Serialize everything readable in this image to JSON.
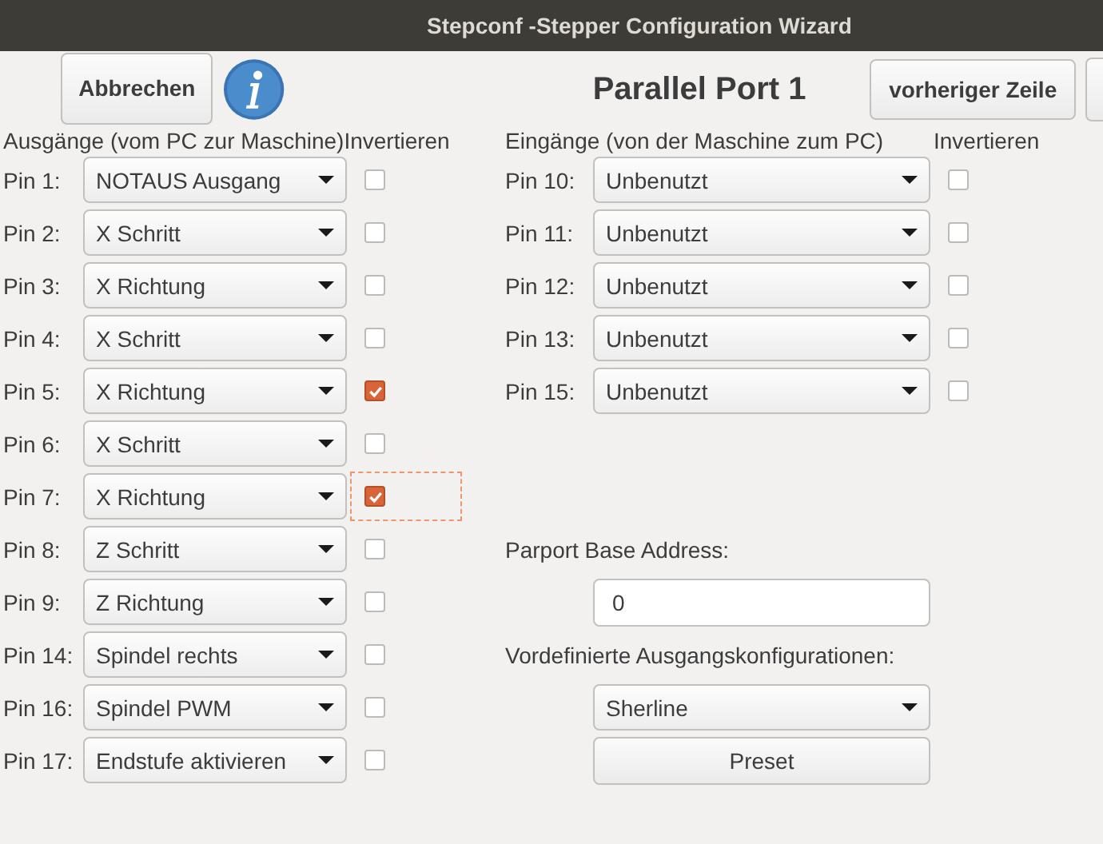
{
  "window": {
    "title": "Stepconf -Stepper Configuration Wizard"
  },
  "toolbar": {
    "cancel_button": "Abbrechen",
    "page_title": "Parallel Port 1",
    "previous_button": "vorheriger Zeile"
  },
  "outputs": {
    "heading": "Ausgänge (vom PC zur Maschine)",
    "invert_heading": "Invertieren",
    "pins": [
      {
        "label": "Pin 1:",
        "value": "NOTAUS Ausgang",
        "checked": false,
        "focused": false
      },
      {
        "label": "Pin 2:",
        "value": "X Schritt",
        "checked": false,
        "focused": false
      },
      {
        "label": "Pin 3:",
        "value": "X Richtung",
        "checked": false,
        "focused": false
      },
      {
        "label": "Pin 4:",
        "value": "X Schritt",
        "checked": false,
        "focused": false
      },
      {
        "label": "Pin 5:",
        "value": "X Richtung",
        "checked": true,
        "focused": false
      },
      {
        "label": "Pin 6:",
        "value": "X Schritt",
        "checked": false,
        "focused": false
      },
      {
        "label": "Pin 7:",
        "value": "X Richtung",
        "checked": true,
        "focused": true
      },
      {
        "label": "Pin 8:",
        "value": "Z Schritt",
        "checked": false,
        "focused": false
      },
      {
        "label": "Pin 9:",
        "value": "Z Richtung",
        "checked": false,
        "focused": false
      },
      {
        "label": "Pin 14:",
        "value": "Spindel rechts",
        "checked": false,
        "focused": false
      },
      {
        "label": "Pin 16:",
        "value": "Spindel PWM",
        "checked": false,
        "focused": false
      },
      {
        "label": "Pin 17:",
        "value": "Endstufe aktivieren",
        "checked": false,
        "focused": false
      }
    ]
  },
  "inputs": {
    "heading": "Eingänge (von der Maschine zum PC)",
    "invert_heading": "Invertieren",
    "pins": [
      {
        "label": "Pin 10:",
        "value": "Unbenutzt",
        "checked": false
      },
      {
        "label": "Pin 11:",
        "value": "Unbenutzt",
        "checked": false
      },
      {
        "label": "Pin 12:",
        "value": "Unbenutzt",
        "checked": false
      },
      {
        "label": "Pin 13:",
        "value": "Unbenutzt",
        "checked": false
      },
      {
        "label": "Pin 15:",
        "value": "Unbenutzt",
        "checked": false
      }
    ]
  },
  "parport": {
    "label": "Parport Base Address:",
    "value": "0"
  },
  "presets": {
    "label": "Vordefinierte Ausgangskonfigurationen:",
    "value": "Sherline",
    "button": "Preset"
  }
}
